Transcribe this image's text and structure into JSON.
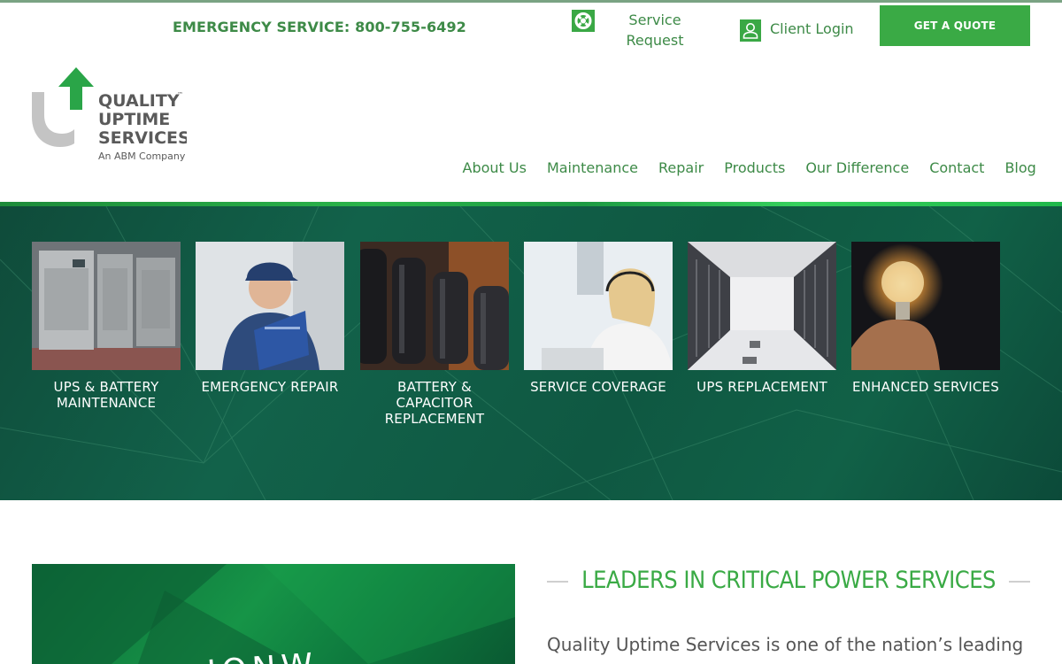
{
  "topbar": {
    "emergency_text": "EMERGENCY SERVICE: 800-755-6492",
    "service_request_line1": "Service",
    "service_request_line2": "Request",
    "client_login": "Client Login",
    "get_quote": "GET A QUOTE",
    "accent_color": "#3aaa45",
    "text_color": "#3d8a47"
  },
  "logo": {
    "line1": "QUALITY",
    "line2": "UPTIME",
    "line3": "SERVICES",
    "tagline": "An ABM Company",
    "tm": "™"
  },
  "nav": {
    "items": [
      "About Us",
      "Maintenance",
      "Repair",
      "Products",
      "Our Difference",
      "Contact",
      "Blog"
    ]
  },
  "services": [
    {
      "label": "UPS & BATTERY MAINTENANCE",
      "image": "ups-cabinets-image"
    },
    {
      "label": "EMERGENCY REPAIR",
      "image": "technician-clipboard-image"
    },
    {
      "label": "BATTERY & CAPACITOR REPLACEMENT",
      "image": "capacitors-image"
    },
    {
      "label": "SERVICE COVERAGE",
      "image": "headset-operator-image"
    },
    {
      "label": "UPS REPLACEMENT",
      "image": "server-room-image"
    },
    {
      "label": "ENHANCED SERVICES",
      "image": "lightbulb-hand-image"
    }
  ],
  "about": {
    "heading": "LEADERS IN CRITICAL POWER SERVICES",
    "intro": "Quality Uptime Services is one of the nation’s leading",
    "promo_word": "IONW"
  }
}
